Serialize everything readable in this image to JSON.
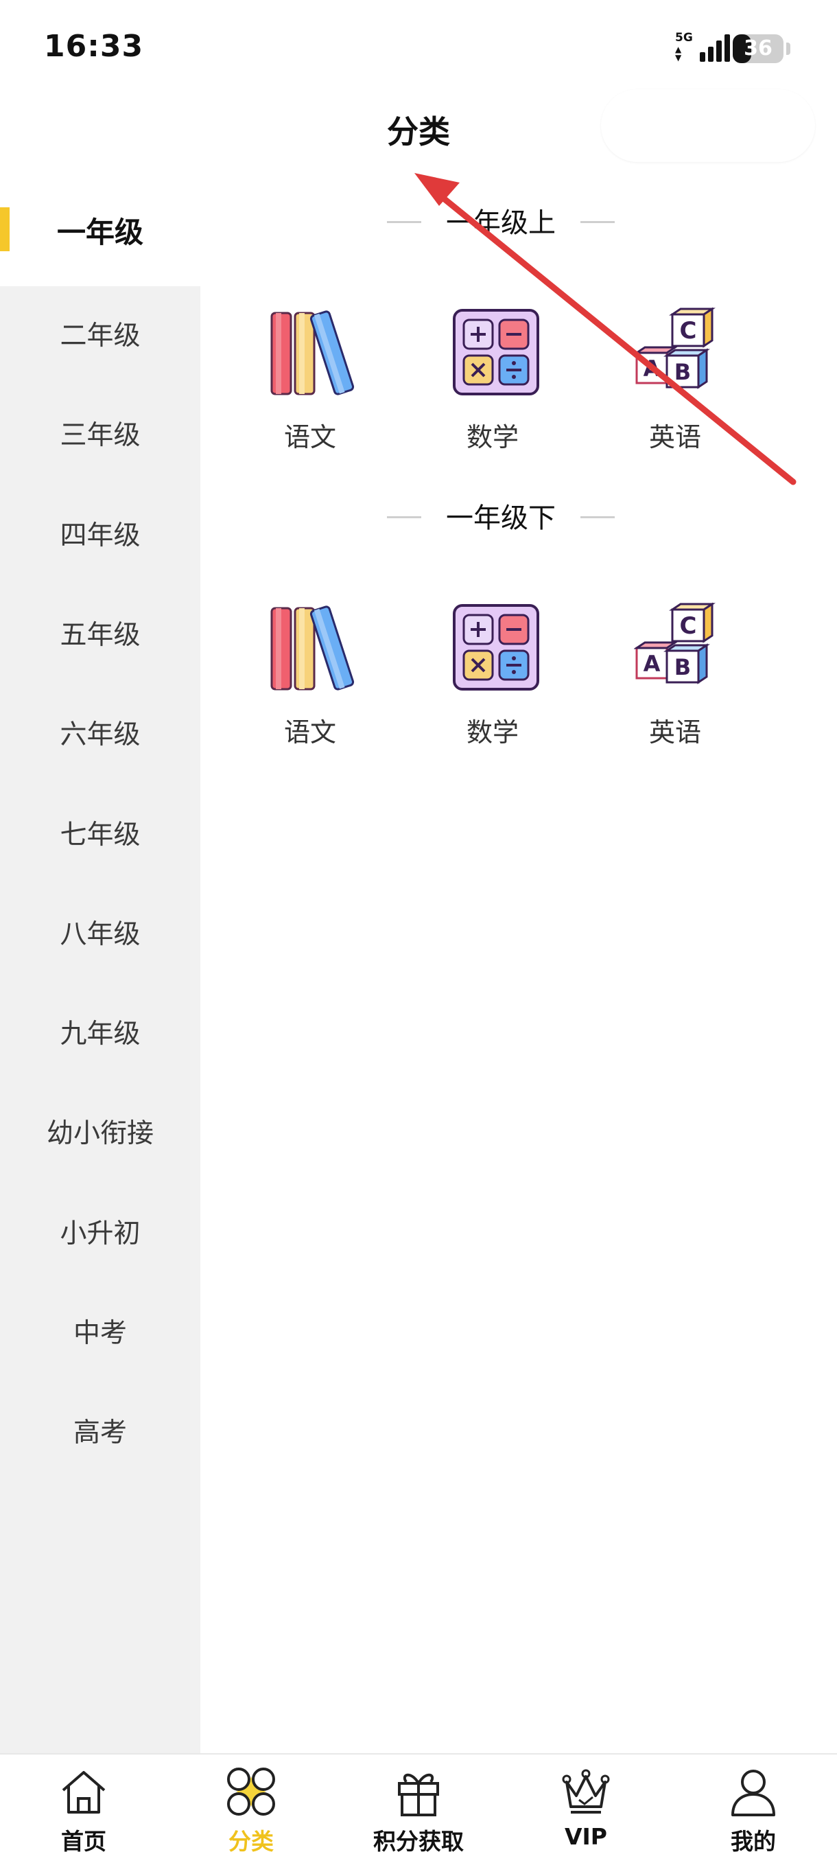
{
  "status_bar": {
    "time": "16:33",
    "network": "5G",
    "battery": "36",
    "battery_fraction": 0.36
  },
  "header": {
    "title": "分类"
  },
  "sidebar": {
    "items": [
      {
        "label": "一年级",
        "active": true
      },
      {
        "label": "二年级"
      },
      {
        "label": "三年级"
      },
      {
        "label": "四年级"
      },
      {
        "label": "五年级"
      },
      {
        "label": "六年级"
      },
      {
        "label": "七年级"
      },
      {
        "label": "八年级"
      },
      {
        "label": "九年级"
      },
      {
        "label": "幼小衔接"
      },
      {
        "label": "小升初"
      },
      {
        "label": "中考"
      },
      {
        "label": "高考"
      }
    ]
  },
  "main": {
    "sections": [
      {
        "title": "一年级上",
        "subjects": [
          {
            "label": "语文",
            "icon": "books-icon"
          },
          {
            "label": "数学",
            "icon": "calculator-icon"
          },
          {
            "label": "英语",
            "icon": "abc-blocks-icon"
          }
        ]
      },
      {
        "title": "一年级下",
        "subjects": [
          {
            "label": "语文",
            "icon": "books-icon"
          },
          {
            "label": "数学",
            "icon": "calculator-icon"
          },
          {
            "label": "英语",
            "icon": "abc-blocks-icon"
          }
        ]
      }
    ]
  },
  "tabbar": {
    "tabs": [
      {
        "label": "首页",
        "icon": "home-icon"
      },
      {
        "label": "分类",
        "icon": "category-icon",
        "active": true
      },
      {
        "label": "积分获取",
        "icon": "gift-icon"
      },
      {
        "label": "VIP",
        "icon": "crown-icon"
      },
      {
        "label": "我的",
        "icon": "user-icon"
      }
    ]
  },
  "colors": {
    "accent": "#f5c72a",
    "tab_active": "#f0c21d",
    "sidebar_bg": "#f1f1f1",
    "annotation_arrow": "#e03a3a"
  }
}
